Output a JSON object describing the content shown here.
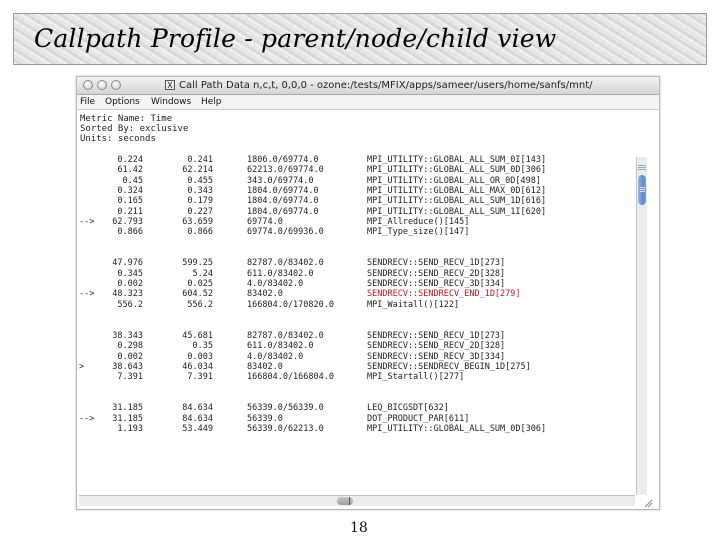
{
  "slide": {
    "title": "Callpath Profile - parent/node/child view",
    "page_number": "18"
  },
  "window": {
    "x_badge": "X",
    "title": "Call Path Data n,c,t, 0,0,0 - ozone:/tests/MFIX/apps/sameer/users/home/sanfs/mnt/",
    "menu": [
      "File",
      "Options",
      "Windows",
      "Help"
    ]
  },
  "metrics": {
    "metric_name": "Metric Name: Time",
    "sorted_by": "Sorted By: exclusive",
    "units": "Units: seconds"
  },
  "groups": [
    {
      "rows": [
        {
          "marker": "",
          "a": "0.224",
          "b": "0.241",
          "calls": "1806.0/69774.0",
          "name": "MPI_UTILITY::GLOBAL_ALL_SUM_0I[143]",
          "highlight": false
        },
        {
          "marker": "",
          "a": "61.42",
          "b": "62.214",
          "calls": "62213.0/69774.0",
          "name": "MPI_UTILITY::GLOBAL_ALL_SUM_0D[306]",
          "highlight": false
        },
        {
          "marker": "",
          "a": "0.45",
          "b": "0.455",
          "calls": "343.0/69774.0",
          "name": "MPI_UTILITY::GLOBAL_ALL_OR_0D[498]",
          "highlight": false
        },
        {
          "marker": "",
          "a": "0.324",
          "b": "0.343",
          "calls": "1804.0/69774.0",
          "name": "MPI_UTILITY::GLOBAL_ALL_MAX_0D[612]",
          "highlight": false
        },
        {
          "marker": "",
          "a": "0.165",
          "b": "0.179",
          "calls": "1804.0/69774.0",
          "name": "MPI_UTILITY::GLOBAL_ALL_SUM_1D[616]",
          "highlight": false
        },
        {
          "marker": "",
          "a": "0.211",
          "b": "0.227",
          "calls": "1804.0/69774.0",
          "name": "MPI_UTILITY::GLOBAL_ALL_SUM_1I[620]",
          "highlight": false
        },
        {
          "marker": "-->",
          "a": "62.793",
          "b": "63.659",
          "calls": "69774.0",
          "name": "MPI_Allreduce()[145]",
          "highlight": false
        },
        {
          "marker": "",
          "a": "0.866",
          "b": "0.866",
          "calls": "69774.0/69936.0",
          "name": "MPI_Type_size()[147]",
          "highlight": false
        }
      ]
    },
    {
      "rows": [
        {
          "marker": "",
          "a": "47.976",
          "b": "599.25",
          "calls": "82787.0/83402.0",
          "name": "SENDRECV::SEND_RECV_1D[273]",
          "highlight": false
        },
        {
          "marker": "",
          "a": "0.345",
          "b": "5.24",
          "calls": "611.0/83402.0",
          "name": "SENDRECV::SEND_RECV_2D[328]",
          "highlight": false
        },
        {
          "marker": "",
          "a": "0.002",
          "b": "0.025",
          "calls": "4.0/83402.0",
          "name": "SENDRECV::SEND_RECV_3D[334]",
          "highlight": false
        },
        {
          "marker": "-->",
          "a": "48.323",
          "b": "604.52",
          "calls": "83402.0",
          "name": "SENDRECV::SENDRECV_END_1D[279]",
          "highlight": true
        },
        {
          "marker": "",
          "a": "556.2",
          "b": "556.2",
          "calls": "166804.0/170820.0",
          "name": "MPI_Waitall()[122]",
          "highlight": false
        }
      ]
    },
    {
      "rows": [
        {
          "marker": "",
          "a": "38.343",
          "b": "45.681",
          "calls": "82787.0/83402.0",
          "name": "SENDRECV::SEND_RECV_1D[273]",
          "highlight": false
        },
        {
          "marker": "",
          "a": "0.298",
          "b": "0.35",
          "calls": "611.0/83402.0",
          "name": "SENDRECV::SEND_RECV_2D[328]",
          "highlight": false
        },
        {
          "marker": "",
          "a": "0.002",
          "b": "0.003",
          "calls": "4.0/83402.0",
          "name": "SENDRECV::SEND_RECV_3D[334]",
          "highlight": false
        },
        {
          "marker": ">",
          "a": "38.643",
          "b": "46.034",
          "calls": "83402.0",
          "name": "SENDRECV::SENDRECV_BEGIN_1D[275]",
          "highlight": false
        },
        {
          "marker": "",
          "a": "7.391",
          "b": "7.391",
          "calls": "166804.0/166804.0",
          "name": "MPI_Startall()[277]",
          "highlight": false
        }
      ]
    },
    {
      "rows": [
        {
          "marker": "",
          "a": "31.185",
          "b": "84.634",
          "calls": "56339.0/56339.0",
          "name": "LEQ_BICGSDT[632]",
          "highlight": false
        },
        {
          "marker": "-->",
          "a": "31.185",
          "b": "84.634",
          "calls": "56339.0",
          "name": "DOT_PRODUCT_PAR[611]",
          "highlight": false
        },
        {
          "marker": "",
          "a": "1.193",
          "b": "53.449",
          "calls": "56339.0/62213.0",
          "name": "MPI_UTILITY::GLOBAL_ALL_SUM_0D[306]",
          "highlight": false
        }
      ]
    }
  ]
}
